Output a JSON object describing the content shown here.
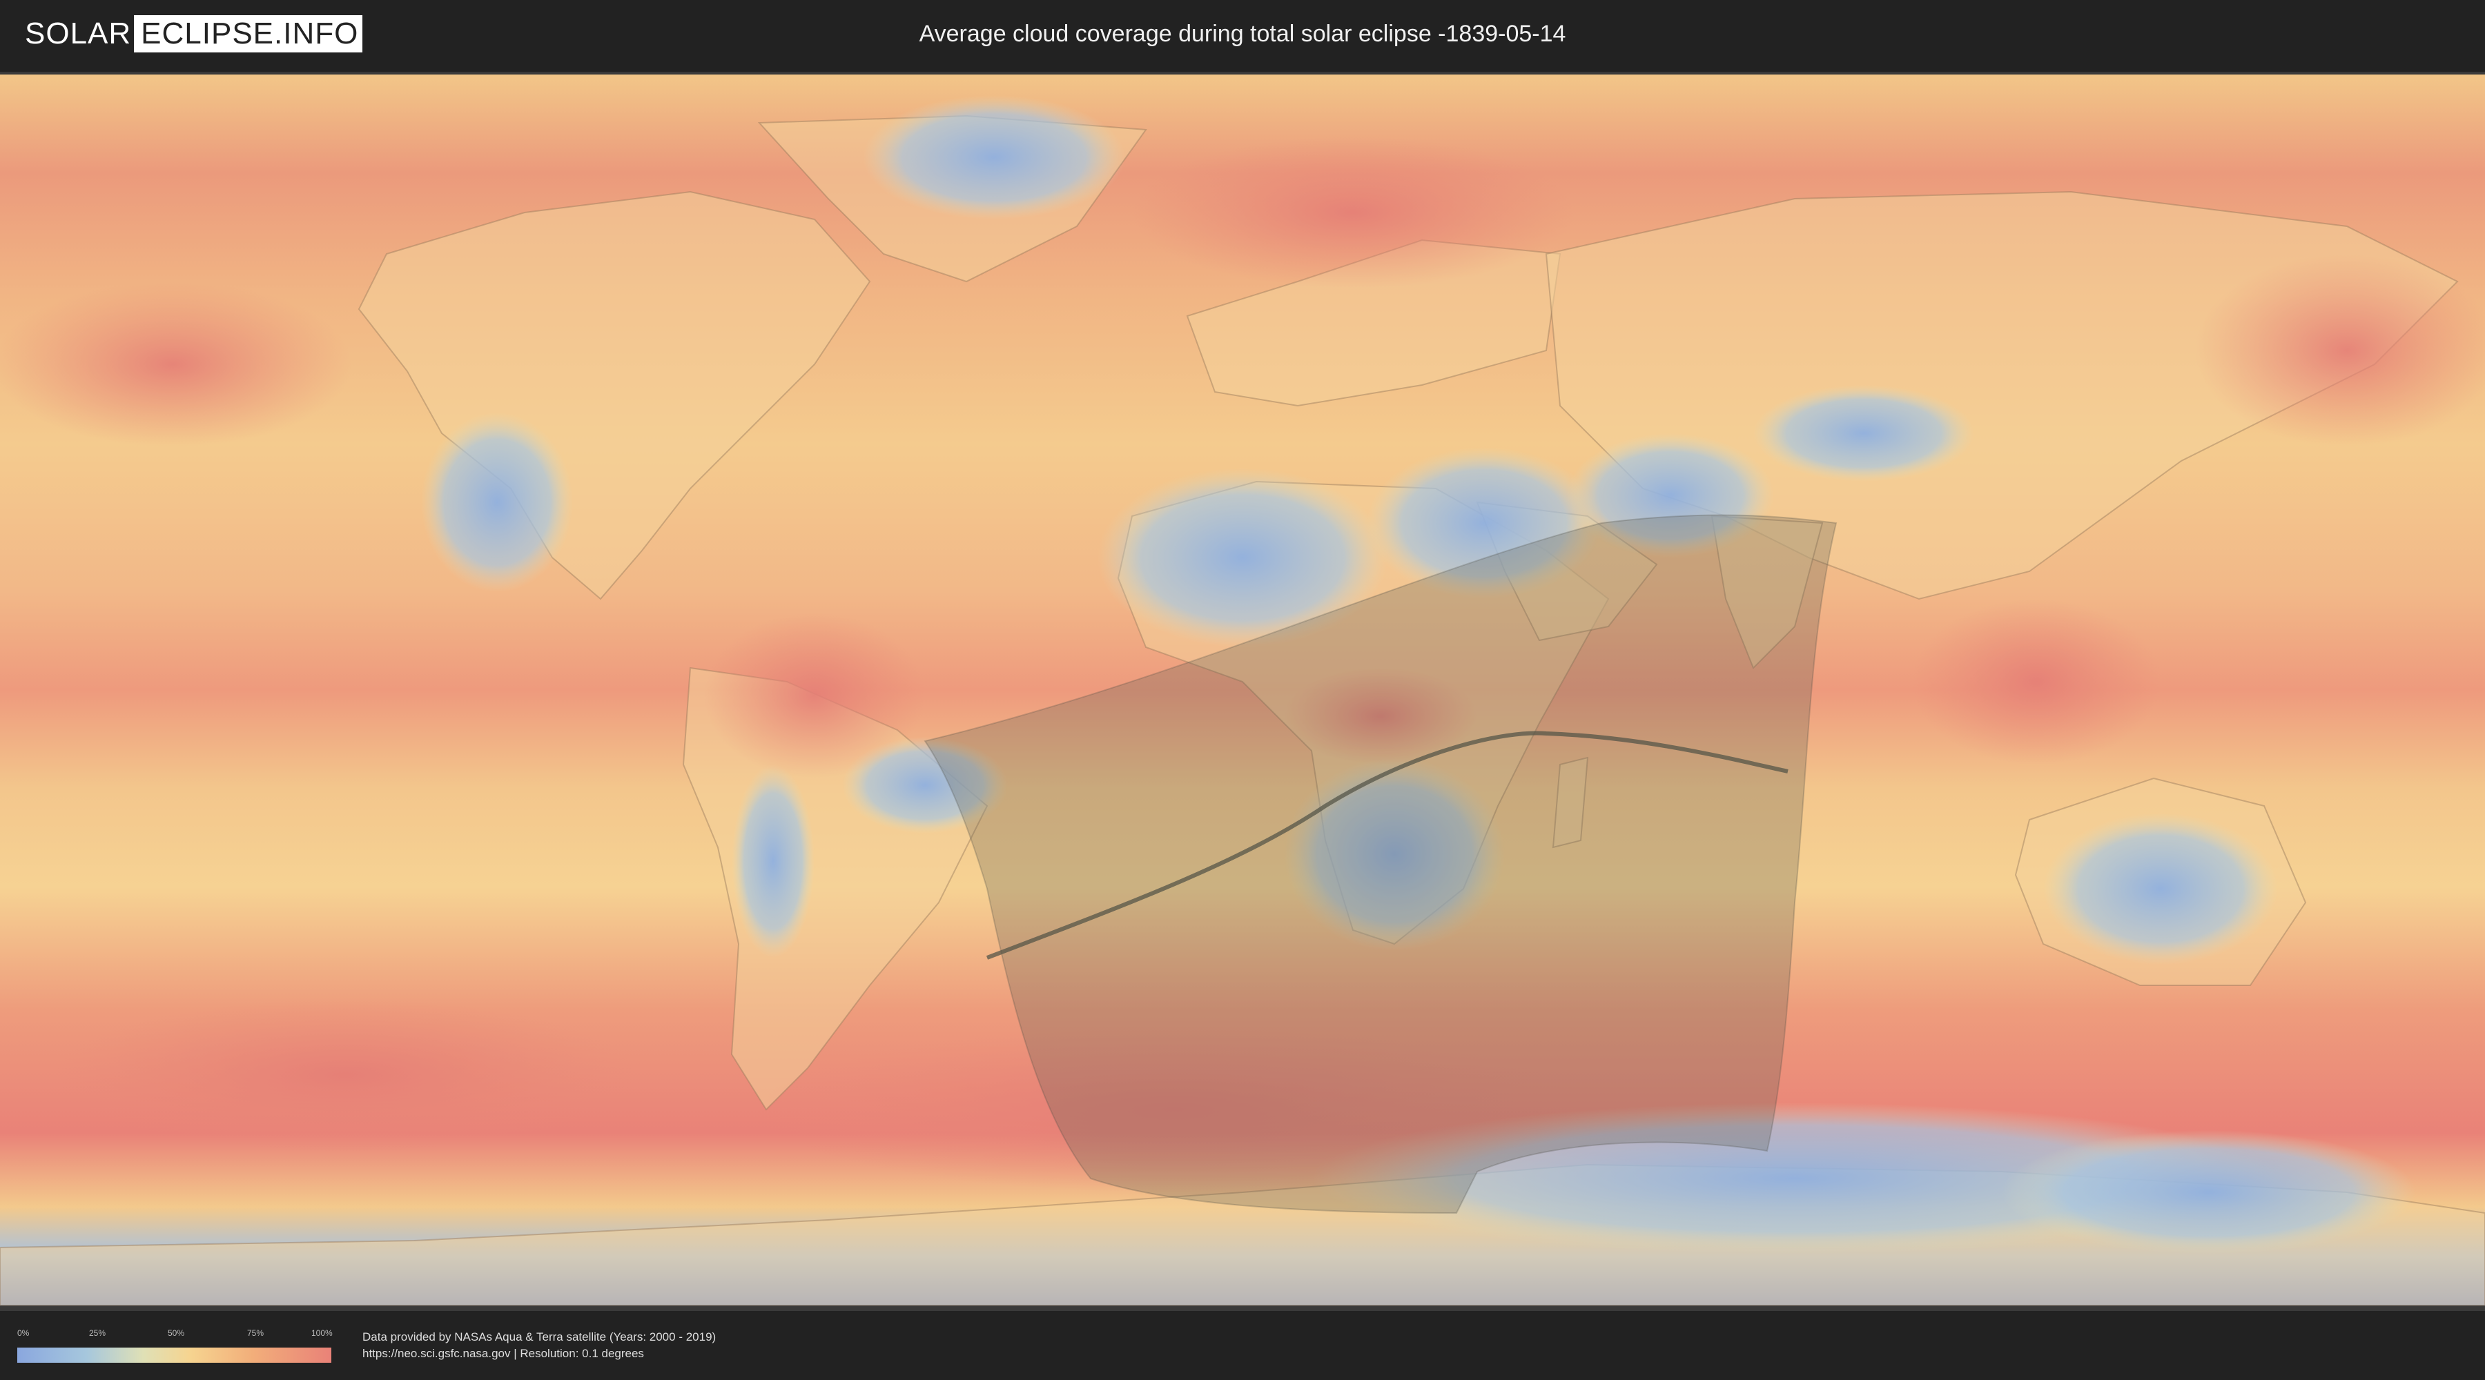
{
  "header": {
    "logo_left": "SOLAR",
    "logo_right": "ECLIPSE.INFO",
    "title": "Average cloud coverage during total solar eclipse -1839-05-14"
  },
  "legend": {
    "labels": [
      "0%",
      "25%",
      "50%",
      "75%",
      "100%"
    ],
    "colors": [
      "#8aa7de",
      "#a6c7dd",
      "#f6d490",
      "#f2ae7a",
      "#e98278"
    ]
  },
  "footer": {
    "credit_line1": "Data provided by NASAs Aqua & Terra satellite (Years: 2000 - 2019)",
    "credit_line2": "https://neo.sci.gsfc.nasa.gov | Resolution: 0.1 degrees"
  },
  "map": {
    "projection": "equirectangular",
    "layer": "average cloud coverage",
    "overlays": [
      "eclipse visibility region (shaded)",
      "path of totality (dark line)"
    ],
    "colors": {
      "ocean_cloudy": "#e98a78",
      "land_mid": "#f3c98a",
      "clear_sky": "#8fb3e0",
      "shadow": "#5a5a50"
    }
  }
}
